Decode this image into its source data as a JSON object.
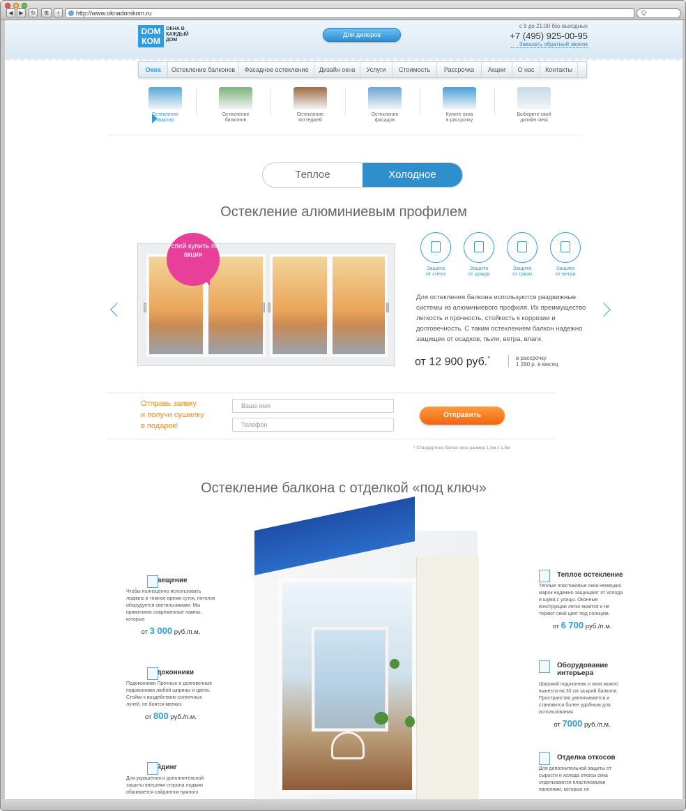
{
  "browser": {
    "address": "http://www.oknadomkom.ru"
  },
  "header": {
    "logo_top": "DOM",
    "logo_bottom": "КОМ",
    "slogan": "Окна в каждый дом",
    "dealers_button": "Для дилеров",
    "hours": "с 9 до 21:00 без выходных",
    "phone": "+7 (495) 925-00-95",
    "callback": "Заказать обратный звонок"
  },
  "menu": [
    {
      "label": "Окна",
      "active": true
    },
    {
      "label": "Остекление балконов",
      "active": false
    },
    {
      "label": "Фасадное остекление",
      "active": false
    },
    {
      "label": "Дизайн окна",
      "active": false
    },
    {
      "label": "Услуги",
      "active": false
    },
    {
      "label": "Стоимость",
      "active": false
    },
    {
      "label": "Рассрочка",
      "active": false
    },
    {
      "label": "Акции",
      "active": false
    },
    {
      "label": "О нас",
      "active": false
    },
    {
      "label": "Контакты",
      "active": false
    }
  ],
  "categories": [
    {
      "line1": "Остекление",
      "line2": "квартир",
      "active": true
    },
    {
      "line1": "Остекление",
      "line2": "балконов",
      "active": false
    },
    {
      "line1": "Остекление",
      "line2": "коттеджей",
      "active": false
    },
    {
      "line1": "Остекление",
      "line2": "фасадов",
      "active": false
    },
    {
      "line1": "Купите окна",
      "line2": "в рассрочку",
      "active": false
    },
    {
      "line1": "Выберите свой",
      "line2": "дизайн окна",
      "active": false
    }
  ],
  "toggle": {
    "warm": "Теплое",
    "cold": "Холодное"
  },
  "profile": {
    "title": "Остекление алюминиевым профилем",
    "promo": "Успей купить по акции",
    "features": [
      {
        "line1": "Защита",
        "line2": "от снега",
        "icon": "snow-protection-icon"
      },
      {
        "line1": "Защита",
        "line2": "от дождя",
        "icon": "rain-protection-icon"
      },
      {
        "line1": "Защита",
        "line2": "от грязи",
        "icon": "dirt-protection-icon"
      },
      {
        "line1": "Защита",
        "line2": "от ветра",
        "icon": "wind-protection-icon"
      }
    ],
    "description": "Для остекления балкона используются раздвижные системы из алюминиевого профиля. Их преимущество легкость и прочность, стойкость к коррозии и долговечность. С таким остеклением балкон надежно защищен от осадков, пыли, ветра, влаги.",
    "price": "от 12 900 руб.",
    "price_mark": "*",
    "installment_line1": "в рассрочку",
    "installment_line2": "1 290 р. в месяц"
  },
  "form": {
    "offer_line1": "Отправь заявку",
    "offer_line2": "и получи сушилку",
    "offer_line3": "в подарок!",
    "name_placeholder": "Ваше имя",
    "phone_placeholder": "Телефон",
    "submit": "Отправить",
    "footnote": "* Стандартное белое окно размер 1,5м х 1,5м"
  },
  "turnkey": {
    "title": "Остекление балкона с отделкой «под ключ»",
    "left": [
      {
        "title": "Освещение",
        "text": "Чтобы полноценно использовать лоджию в темное время суток, потолок оборудуется светильниками. Мы применяем современные лампы, которые",
        "price_prefix": "от",
        "price_value": "3 000",
        "price_unit": "руб./п.м.",
        "icon": "lamp-icon"
      },
      {
        "title": "Подоконники",
        "text": "Подоконники Прочные и долговечные подоконники любой ширины и цвета. Стойки к воздействию солнечных лучей, не боятся мелких",
        "price_prefix": "от",
        "price_value": "800",
        "price_unit": "руб./п.м.",
        "icon": "windowsill-icon"
      },
      {
        "title": "Сайдинг",
        "text": "Для украшения и дополнительной защиты внешняя сторона лоджии обшивается сайдингом нужного",
        "price_prefix": "",
        "price_value": "",
        "price_unit": "",
        "icon": "siding-icon"
      }
    ],
    "right": [
      {
        "title": "Теплое остекление",
        "text": "Теплые пластиковые окна немецких марок надежно защищают от холода и шума с улицы. Оконные конструкции легко моются и не теряют свой цвет под солнцем.",
        "price_prefix": "от",
        "price_value": "6 700",
        "price_unit": "руб./п.м.",
        "icon": "warm-glazing-icon"
      },
      {
        "title": "Оборудование интерьера",
        "text": "Широкий подоконник и окна можно вынести на 30 см за край балкона. Пространство увеличивается и становится более удобным для использования.",
        "price_prefix": "от",
        "price_value": "7000",
        "price_unit": "руб./п.м.",
        "icon": "interior-icon"
      },
      {
        "title": "Отделка откосов",
        "text": "Для дополнительной защиты от сырости и холода откосы окна отделываются пластиковыми панелями, которые не",
        "price_prefix": "",
        "price_value": "",
        "price_unit": "",
        "icon": "slopes-icon"
      }
    ]
  },
  "colors": {
    "brand_blue": "#2f9ddd",
    "accent_orange": "#f08a24",
    "promo_pink": "#e8409a",
    "toggle_active": "#2f8fcc"
  }
}
